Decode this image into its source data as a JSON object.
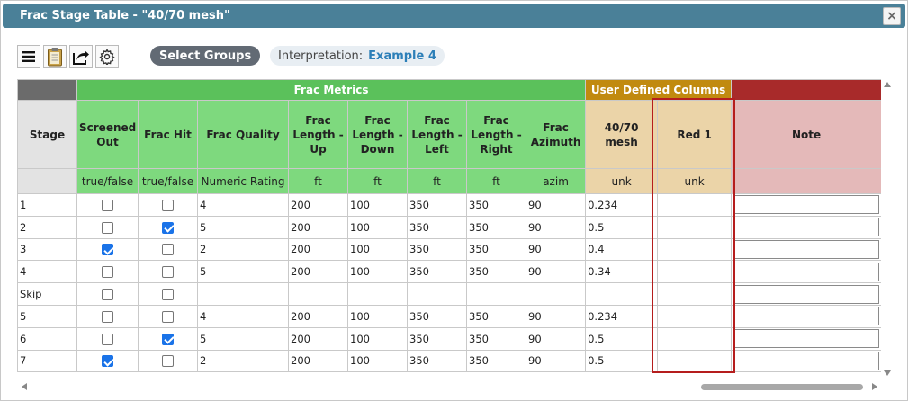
{
  "window": {
    "title": "Frac Stage Table - \"40/70 mesh\"",
    "close_label": "×"
  },
  "toolbar": {
    "icons": [
      "menu-icon",
      "clipboard-icon",
      "export-icon",
      "gear-icon"
    ],
    "select_groups_label": "Select Groups",
    "interpretation_label": "Interpretation:",
    "interpretation_value": "Example 4"
  },
  "groups": {
    "metrics": "Frac Metrics",
    "user_defined": "User Defined Columns"
  },
  "columns": [
    {
      "header": "Stage",
      "unit": ""
    },
    {
      "header": "Screened Out",
      "unit": "true/false"
    },
    {
      "header": "Frac Hit",
      "unit": "true/false"
    },
    {
      "header": "Frac Quality",
      "unit": "Numeric Rating"
    },
    {
      "header": "Frac Length - Up",
      "unit": "ft"
    },
    {
      "header": "Frac Length - Down",
      "unit": "ft"
    },
    {
      "header": "Frac Length - Left",
      "unit": "ft"
    },
    {
      "header": "Frac Length - Right",
      "unit": "ft"
    },
    {
      "header": "Frac Azimuth",
      "unit": "azim"
    },
    {
      "header": "40/70 mesh",
      "unit": "unk"
    },
    {
      "header": "Red 1",
      "unit": "unk"
    },
    {
      "header": "Note",
      "unit": ""
    }
  ],
  "rows": [
    {
      "stage": "1",
      "screened": false,
      "hit": false,
      "quality": "4",
      "up": "200",
      "down": "100",
      "left": "350",
      "right": "350",
      "azimuth": "90",
      "mesh": "0.234",
      "red1": "",
      "note": ""
    },
    {
      "stage": "2",
      "screened": false,
      "hit": true,
      "quality": "5",
      "up": "200",
      "down": "100",
      "left": "350",
      "right": "350",
      "azimuth": "90",
      "mesh": "0.5",
      "red1": "",
      "note": ""
    },
    {
      "stage": "3",
      "screened": true,
      "hit": false,
      "quality": "2",
      "up": "200",
      "down": "100",
      "left": "350",
      "right": "350",
      "azimuth": "90",
      "mesh": "0.4",
      "red1": "",
      "note": ""
    },
    {
      "stage": "4",
      "screened": false,
      "hit": false,
      "quality": "5",
      "up": "200",
      "down": "100",
      "left": "350",
      "right": "350",
      "azimuth": "90",
      "mesh": "0.34",
      "red1": "",
      "note": ""
    },
    {
      "stage": "Skip",
      "screened": false,
      "hit": false,
      "quality": "",
      "up": "",
      "down": "",
      "left": "",
      "right": "",
      "azimuth": "",
      "mesh": "",
      "red1": "",
      "note": ""
    },
    {
      "stage": "5",
      "screened": false,
      "hit": false,
      "quality": "4",
      "up": "200",
      "down": "100",
      "left": "350",
      "right": "350",
      "azimuth": "90",
      "mesh": "0.234",
      "red1": "",
      "note": ""
    },
    {
      "stage": "6",
      "screened": false,
      "hit": true,
      "quality": "5",
      "up": "200",
      "down": "100",
      "left": "350",
      "right": "350",
      "azimuth": "90",
      "mesh": "0.5",
      "red1": "",
      "note": ""
    },
    {
      "stage": "7",
      "screened": true,
      "hit": false,
      "quality": "2",
      "up": "200",
      "down": "100",
      "left": "350",
      "right": "350",
      "azimuth": "90",
      "mesh": "0.5",
      "red1": "",
      "note": ""
    }
  ],
  "colors": {
    "titlebar": "#4a8098",
    "group_metrics": "#5bc15b",
    "group_user": "#c18a0f",
    "group_note": "#a82a2a",
    "highlight": "#b51d1d"
  }
}
